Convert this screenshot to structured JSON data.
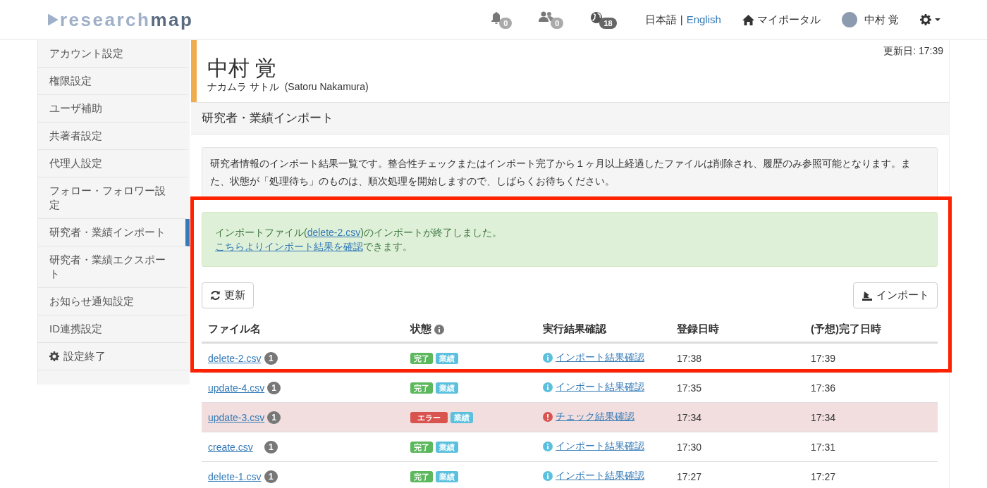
{
  "header": {
    "logo": {
      "light": "research",
      "dark": "map"
    },
    "notifications": [
      {
        "kind": "bell",
        "count": "0"
      },
      {
        "kind": "users",
        "count": "0"
      },
      {
        "kind": "globe",
        "count": "18"
      }
    ],
    "languages": [
      {
        "label": "日本語",
        "selected": true
      },
      {
        "label": "English",
        "selected": false
      }
    ],
    "language_separator": "|",
    "portal": "マイポータル",
    "user": "中村 覚"
  },
  "sidebar": {
    "items": [
      {
        "label": "アカウント設定",
        "selected": false,
        "kind": "link"
      },
      {
        "label": "権限設定",
        "selected": false,
        "kind": "link"
      },
      {
        "label": "ユーザ補助",
        "selected": false,
        "kind": "link"
      },
      {
        "label": "共著者設定",
        "selected": false,
        "kind": "link"
      },
      {
        "label": "代理人設定",
        "selected": false,
        "kind": "link"
      },
      {
        "label": "フォロー・フォロワー設定",
        "selected": false,
        "kind": "link"
      },
      {
        "label": "研究者・業績インポート",
        "selected": true,
        "kind": "link"
      },
      {
        "label": "研究者・業績エクスポート",
        "selected": false,
        "kind": "link"
      },
      {
        "label": "お知らせ通知設定",
        "selected": false,
        "kind": "link"
      },
      {
        "label": "ID連携設定",
        "selected": false,
        "kind": "link"
      },
      {
        "label": "設定終了",
        "selected": false,
        "kind": "exit"
      }
    ]
  },
  "profile": {
    "updated": "更新日: 17:39",
    "name": "中村 覚",
    "reading": "ナカムラ サトル  (Satoru Nakamura)"
  },
  "section_title": "研究者・業績インポート",
  "description": "研究者情報のインポート結果一覧です。整合性チェックまたはインポート完了から１ヶ月以上経過したファイルは削除され、履歴のみ参照可能となります。また、状態が「処理待ち」のものは、順次処理を開始しますので、しばらくお待ちください。",
  "alert": {
    "line1_before": "インポートファイル(",
    "line1_link": "delete-2.csv",
    "line1_after": ")のインポートが終了しました。",
    "line2_link": "こちらよりインポート結果を確認",
    "line2_after": "できます。"
  },
  "buttons": {
    "refresh": "更新",
    "import": "インポート"
  },
  "table": {
    "columns": [
      "ファイル名",
      "状態",
      "実行結果確認",
      "登録日時",
      "(予想)完了日時"
    ],
    "rows": [
      {
        "file": "delete-2.csv",
        "count": "1",
        "status": {
          "kind": "done",
          "label": "完了"
        },
        "category": "業績",
        "check": {
          "kind": "info",
          "label": "インポート結果確認"
        },
        "registered": "17:38",
        "completed": "17:39"
      },
      {
        "file": "update-4.csv",
        "count": "1",
        "status": {
          "kind": "done",
          "label": "完了"
        },
        "category": "業績",
        "check": {
          "kind": "info",
          "label": "インポート結果確認"
        },
        "registered": "17:35",
        "completed": "17:36"
      },
      {
        "file": "update-3.csv",
        "count": "1",
        "status": {
          "kind": "error",
          "label": "エラー"
        },
        "category": "業績",
        "check": {
          "kind": "error",
          "label": "チェック結果確認"
        },
        "registered": "17:34",
        "completed": "17:34"
      },
      {
        "file": "create.csv",
        "count": "1",
        "status": {
          "kind": "done",
          "label": "完了"
        },
        "category": "業績",
        "check": {
          "kind": "info",
          "label": "インポート結果確認"
        },
        "registered": "17:30",
        "completed": "17:31"
      },
      {
        "file": "delete-1.csv",
        "count": "1",
        "status": {
          "kind": "done",
          "label": "完了"
        },
        "category": "業績",
        "check": {
          "kind": "info",
          "label": "インポート結果確認"
        },
        "registered": "17:27",
        "completed": "17:27"
      }
    ]
  }
}
